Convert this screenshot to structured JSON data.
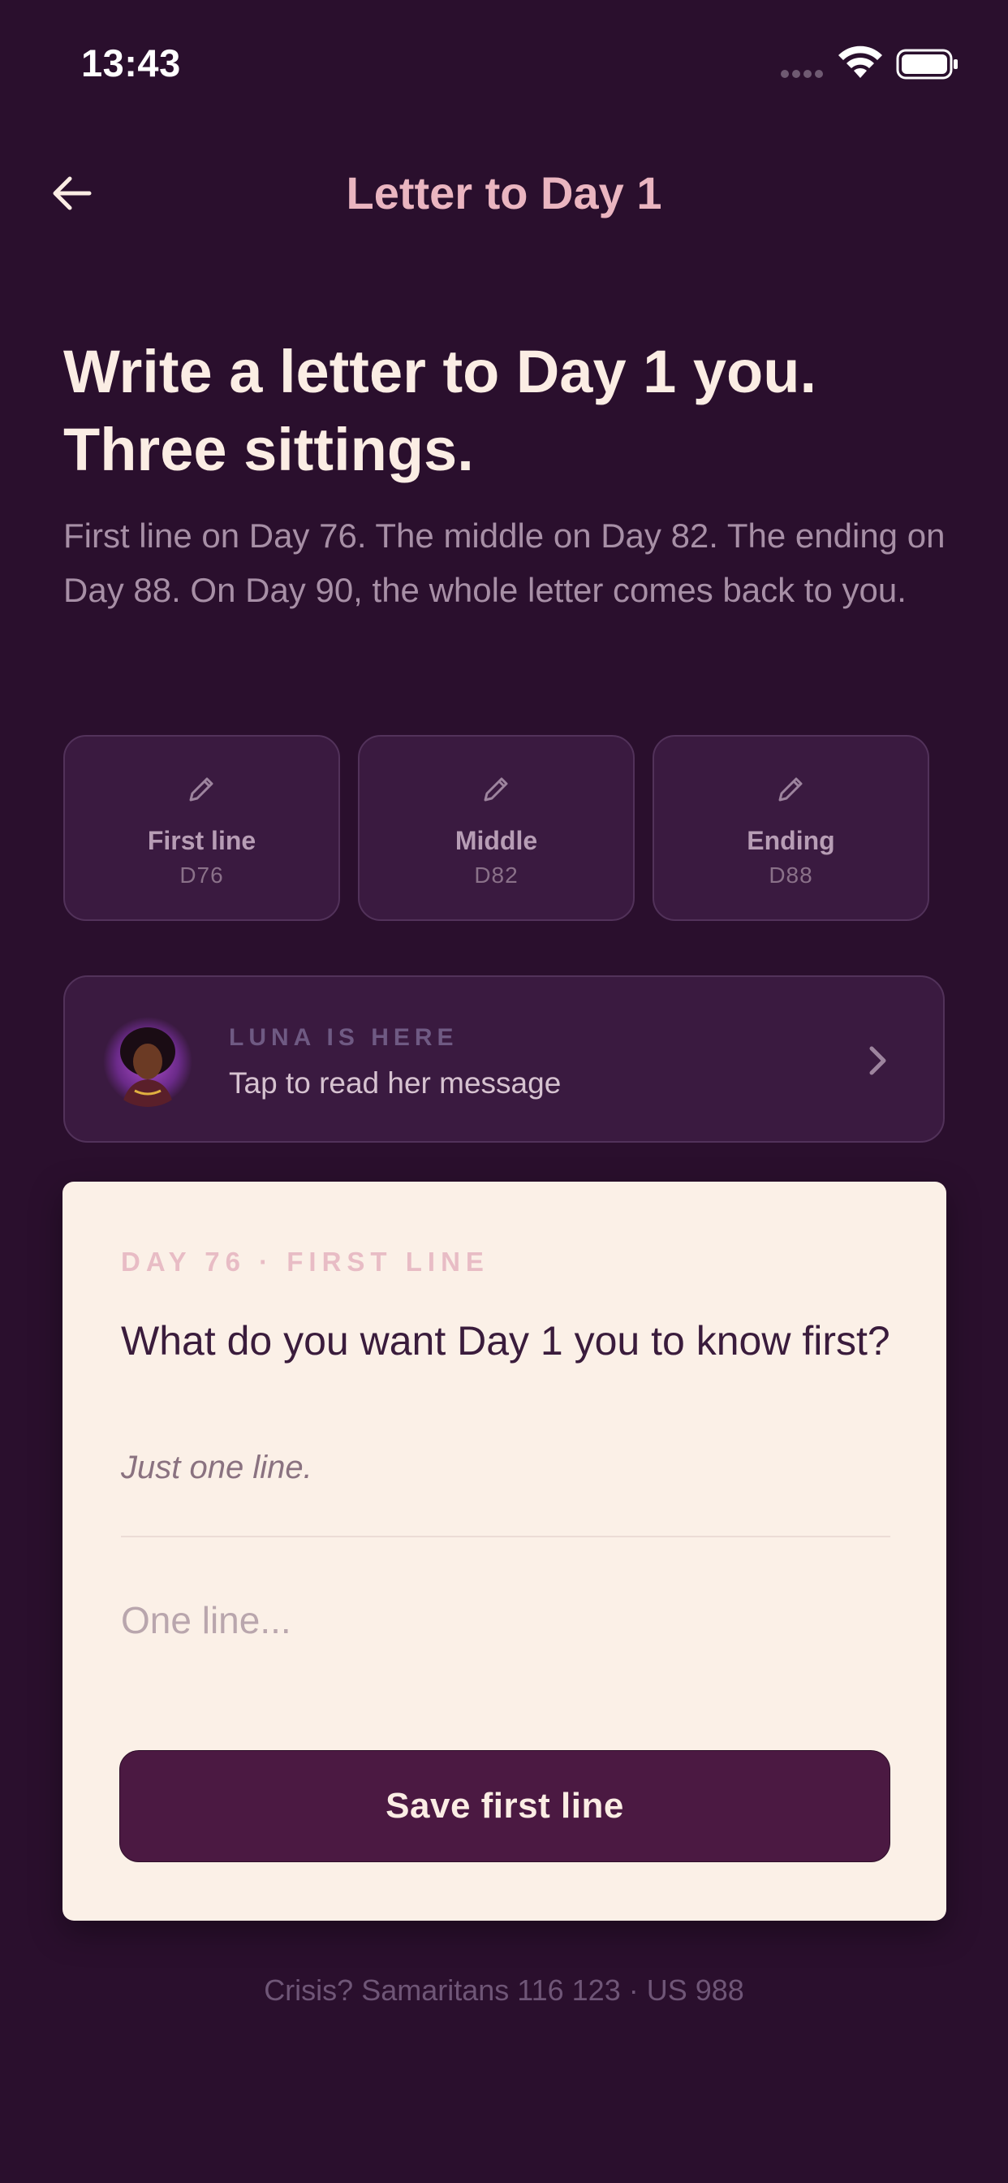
{
  "status_bar": {
    "time": "13:43",
    "icons": [
      "signal-dots",
      "wifi-icon",
      "battery-icon"
    ]
  },
  "header": {
    "back_icon": "arrow-left-icon",
    "title": "Letter to Day 1"
  },
  "headline": {
    "title_line1": "Write a letter to Day 1 you.",
    "title_line2": "Three sittings.",
    "description": "First line on Day 76. The middle on Day 82. The ending on Day 88. On Day 90, the whole letter comes back to you."
  },
  "sittings": [
    {
      "icon": "pencil-icon",
      "label": "First line",
      "day": "D76"
    },
    {
      "icon": "pencil-icon",
      "label": "Middle",
      "day": "D82"
    },
    {
      "icon": "pencil-icon",
      "label": "Ending",
      "day": "D88"
    }
  ],
  "luna": {
    "eyebrow": "LUNA IS HERE",
    "subtitle": "Tap to read her message",
    "chevron_icon": "chevron-right-icon"
  },
  "letter_card": {
    "eyebrow": "DAY 76 · FIRST LINE",
    "question": "What do you want Day 1 you to know first?",
    "hint": "Just one line.",
    "input_value": "",
    "input_placeholder": "One line...",
    "save_label": "Save first line"
  },
  "footer": {
    "crisis": "Crisis? Samaritans 116 123 · US 988"
  },
  "colors": {
    "background": "#2a0f2d",
    "card_dark": "#3a1a40",
    "accent_pink": "#eab5c0",
    "card_light": "#fbf0e7",
    "button": "#4b1942"
  }
}
